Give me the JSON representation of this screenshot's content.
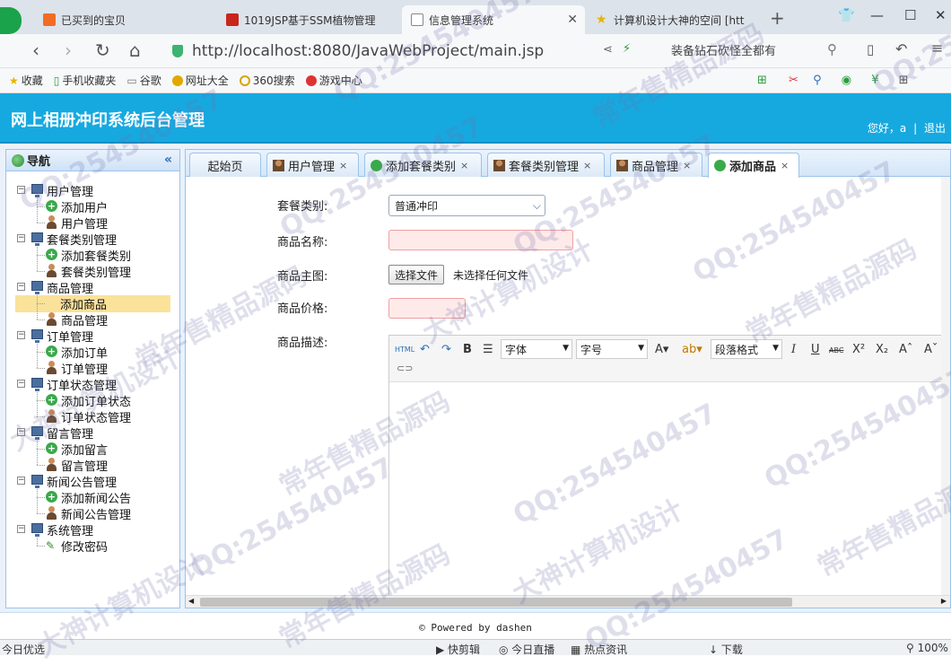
{
  "browser": {
    "tabs": [
      {
        "title": "已买到的宝贝"
      },
      {
        "title": "1019JSP基于SSM植物管理"
      },
      {
        "title": "信息管理系统"
      },
      {
        "title": "计算机设计大神的空间 [htt"
      }
    ],
    "url": "http://localhost:8080/JavaWebProject/main.jsp",
    "search_hint": "装备钻石砍怪全都有",
    "bookmarks": [
      "收藏",
      "手机收藏夹",
      "谷歌",
      "网址大全",
      "360搜索",
      "游戏中心"
    ]
  },
  "app": {
    "title": "网上相册冲印系统后台管理",
    "greeting": "您好，",
    "user": "a",
    "separator": "|",
    "logout": "退出"
  },
  "nav": {
    "title": "导航",
    "collapse": "«",
    "groups": [
      {
        "label": "用户管理",
        "children": [
          "添加用户",
          "用户管理"
        ]
      },
      {
        "label": "套餐类别管理",
        "children": [
          "添加套餐类别",
          "套餐类别管理"
        ]
      },
      {
        "label": "商品管理",
        "children": [
          "添加商品",
          "商品管理"
        ]
      },
      {
        "label": "订单管理",
        "children": [
          "添加订单",
          "订单管理"
        ]
      },
      {
        "label": "订单状态管理",
        "children": [
          "添加订单状态",
          "订单状态管理"
        ]
      },
      {
        "label": "留言管理",
        "children": [
          "添加留言",
          "留言管理"
        ]
      },
      {
        "label": "新闻公告管理",
        "children": [
          "添加新闻公告",
          "新闻公告管理"
        ]
      },
      {
        "label": "系统管理",
        "children": [
          "修改密码"
        ]
      }
    ],
    "selected": "添加商品"
  },
  "tabs": [
    "起始页",
    "用户管理",
    "添加套餐类别",
    "套餐类别管理",
    "商品管理",
    "添加商品"
  ],
  "form": {
    "category_label": "套餐类别:",
    "category_value": "普通冲印",
    "name_label": "商品名称:",
    "image_label": "商品主图:",
    "file_button": "选择文件",
    "file_status": "未选择任何文件",
    "price_label": "商品价格:",
    "desc_label": "商品描述:"
  },
  "editor": {
    "html": "HTML",
    "bold": "B",
    "italic": "I",
    "underline": "U",
    "strike": "ABC",
    "font_family": "字体",
    "font_size": "字号",
    "paragraph": "段落格式"
  },
  "footer": "© Powered by dashen",
  "status": {
    "left": "今日优选",
    "items": [
      "快剪辑",
      "今日直播",
      "热点资讯",
      "下载"
    ],
    "zoom": "100%"
  },
  "watermarks": [
    "QQ:254540457",
    "常年售精品源码",
    "大神计算机设计"
  ]
}
